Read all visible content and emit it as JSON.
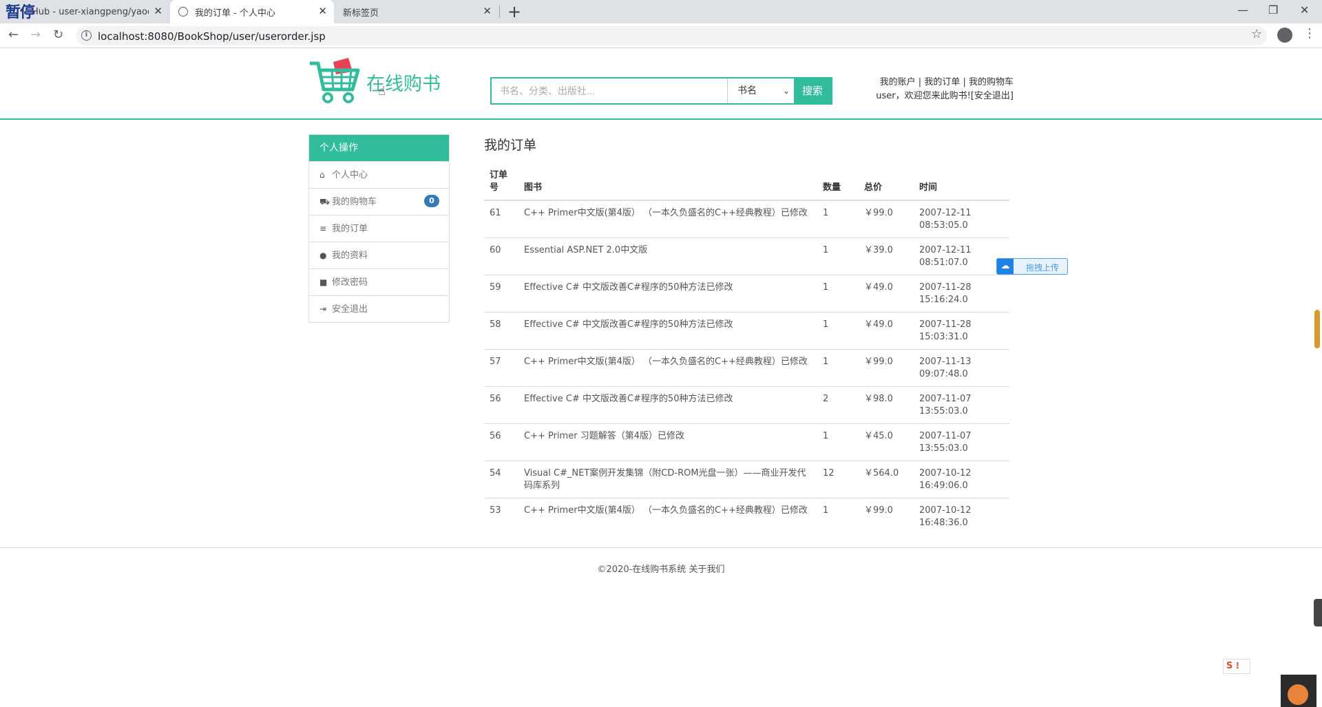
{
  "browser": {
    "overlay_text": "暂停",
    "tabs": [
      {
        "title": "Hub - user-xiangpeng/yaoc"
      },
      {
        "title": "我的订单 - 个人中心"
      },
      {
        "title": "新标签页"
      }
    ],
    "url": "localhost:8080/BookShop/user/userorder.jsp"
  },
  "header": {
    "logo_text": "在线购书",
    "search": {
      "placeholder": "书名、分类、出版社...",
      "select_value": "书名",
      "button_label": "搜索"
    },
    "user_links": {
      "account": "我的账户",
      "orders": "我的订单",
      "cart": "我的购物车",
      "welcome": "user，欢迎您来此购书!",
      "logout": "[安全退出]"
    }
  },
  "sidebar": {
    "title": "个人操作",
    "items": [
      {
        "label": "个人中心",
        "icon": "home-icon"
      },
      {
        "label": "我的购物车",
        "icon": "cart-icon",
        "badge": "0"
      },
      {
        "label": "我的订单",
        "icon": "list-icon"
      },
      {
        "label": "我的资料",
        "icon": "user-icon"
      },
      {
        "label": "修改密码",
        "icon": "lock-icon"
      },
      {
        "label": "安全退出",
        "icon": "logout-icon"
      }
    ]
  },
  "orders": {
    "title": "我的订单",
    "columns": [
      "订单号",
      "图书",
      "数量",
      "总价",
      "时间"
    ],
    "rows": [
      {
        "id": "61",
        "book": "C++ Primer中文版(第4版） （一本久负盛名的C++经典教程）已修改",
        "qty": "1",
        "total": "￥99.0",
        "date": "2007-12-11",
        "time": "08:53:05.0"
      },
      {
        "id": "60",
        "book": "Essential ASP.NET 2.0中文版",
        "qty": "1",
        "total": "￥39.0",
        "date": "2007-12-11",
        "time": "08:51:07.0"
      },
      {
        "id": "59",
        "book": "Effective C# 中文版改善C#程序的50种方法已修改",
        "qty": "1",
        "total": "￥49.0",
        "date": "2007-11-28",
        "time": "15:16:24.0"
      },
      {
        "id": "58",
        "book": "Effective C# 中文版改善C#程序的50种方法已修改",
        "qty": "1",
        "total": "￥49.0",
        "date": "2007-11-28",
        "time": "15:03:31.0"
      },
      {
        "id": "57",
        "book": "C++ Primer中文版(第4版） （一本久负盛名的C++经典教程）已修改",
        "qty": "1",
        "total": "￥99.0",
        "date": "2007-11-13",
        "time": "09:07:48.0"
      },
      {
        "id": "56",
        "book": "Effective C# 中文版改善C#程序的50种方法已修改",
        "qty": "2",
        "total": "￥98.0",
        "date": "2007-11-07",
        "time": "13:55:03.0"
      },
      {
        "id": "56",
        "book": "C++ Primer 习题解答（第4版）已修改",
        "qty": "1",
        "total": "￥45.0",
        "date": "2007-11-07",
        "time": "13:55:03.0"
      },
      {
        "id": "54",
        "book": "Visual C#_NET案例开发集锦（附CD-ROM光盘一张）——商业开发代码库系列",
        "qty": "12",
        "total": "￥564.0",
        "date": "2007-10-12",
        "time": "16:49:06.0"
      },
      {
        "id": "53",
        "book": "C++ Primer中文版(第4版） （一本久负盛名的C++经典教程）已修改",
        "qty": "1",
        "total": "￥99.0",
        "date": "2007-10-12",
        "time": "16:48:36.0"
      }
    ]
  },
  "footer": {
    "text": "©2020-在线购书系统 关于我们"
  },
  "widgets": {
    "upload_label": "拖拽上传",
    "ime_label": "S"
  },
  "colors": {
    "accent": "#31bd9c",
    "badge": "#337ab7"
  }
}
